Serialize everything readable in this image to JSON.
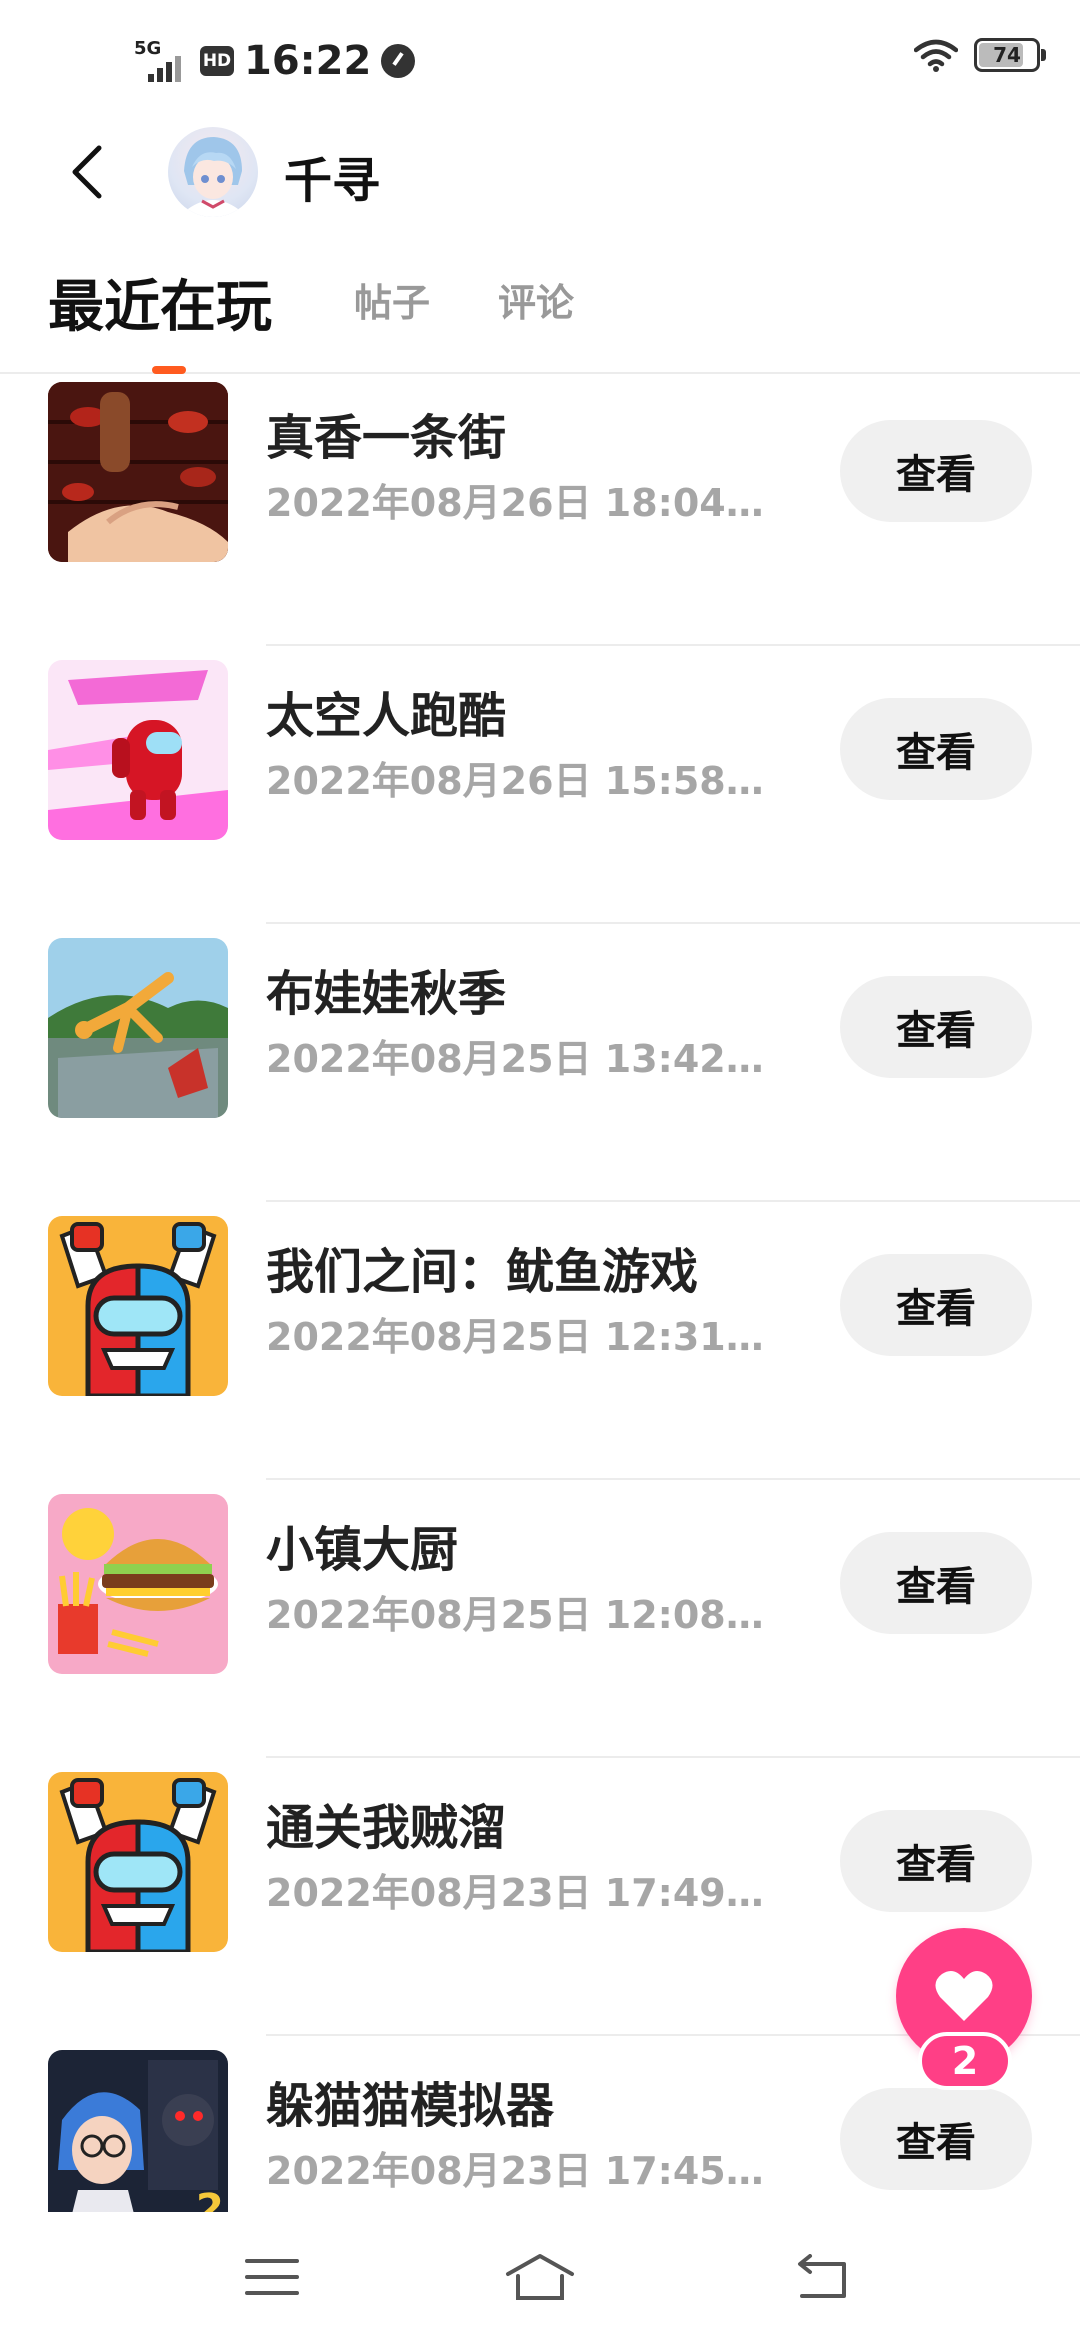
{
  "status_bar": {
    "network": "5G",
    "hd": "HD",
    "time": "16:22",
    "battery": "74"
  },
  "header": {
    "user_name": "千寻"
  },
  "tabs": [
    {
      "label": "最近在玩"
    },
    {
      "label": "帖子"
    },
    {
      "label": "评论"
    }
  ],
  "games": [
    {
      "title": "真香一条街",
      "time": "2022年08月26日 18:04…",
      "button": "查看"
    },
    {
      "title": "太空人跑酷",
      "time": "2022年08月26日 15:58…",
      "button": "查看"
    },
    {
      "title": "布娃娃秋季",
      "time": "2022年08月25日 13:42…",
      "button": "查看"
    },
    {
      "title": "我们之间：鱿鱼游戏",
      "time": "2022年08月25日 12:31…",
      "button": "查看"
    },
    {
      "title": "小镇大厨",
      "time": "2022年08月25日 12:08…",
      "button": "查看"
    },
    {
      "title": "通关我贼溜",
      "time": "2022年08月23日 17:49…",
      "button": "查看"
    },
    {
      "title": "躲猫猫模拟器",
      "time": "2022年08月23日 17:45…",
      "button": "查看"
    }
  ],
  "fab": {
    "icon": "heart-icon",
    "count": "2",
    "color": "#ff3f86"
  },
  "accent": "#ff5b1f"
}
